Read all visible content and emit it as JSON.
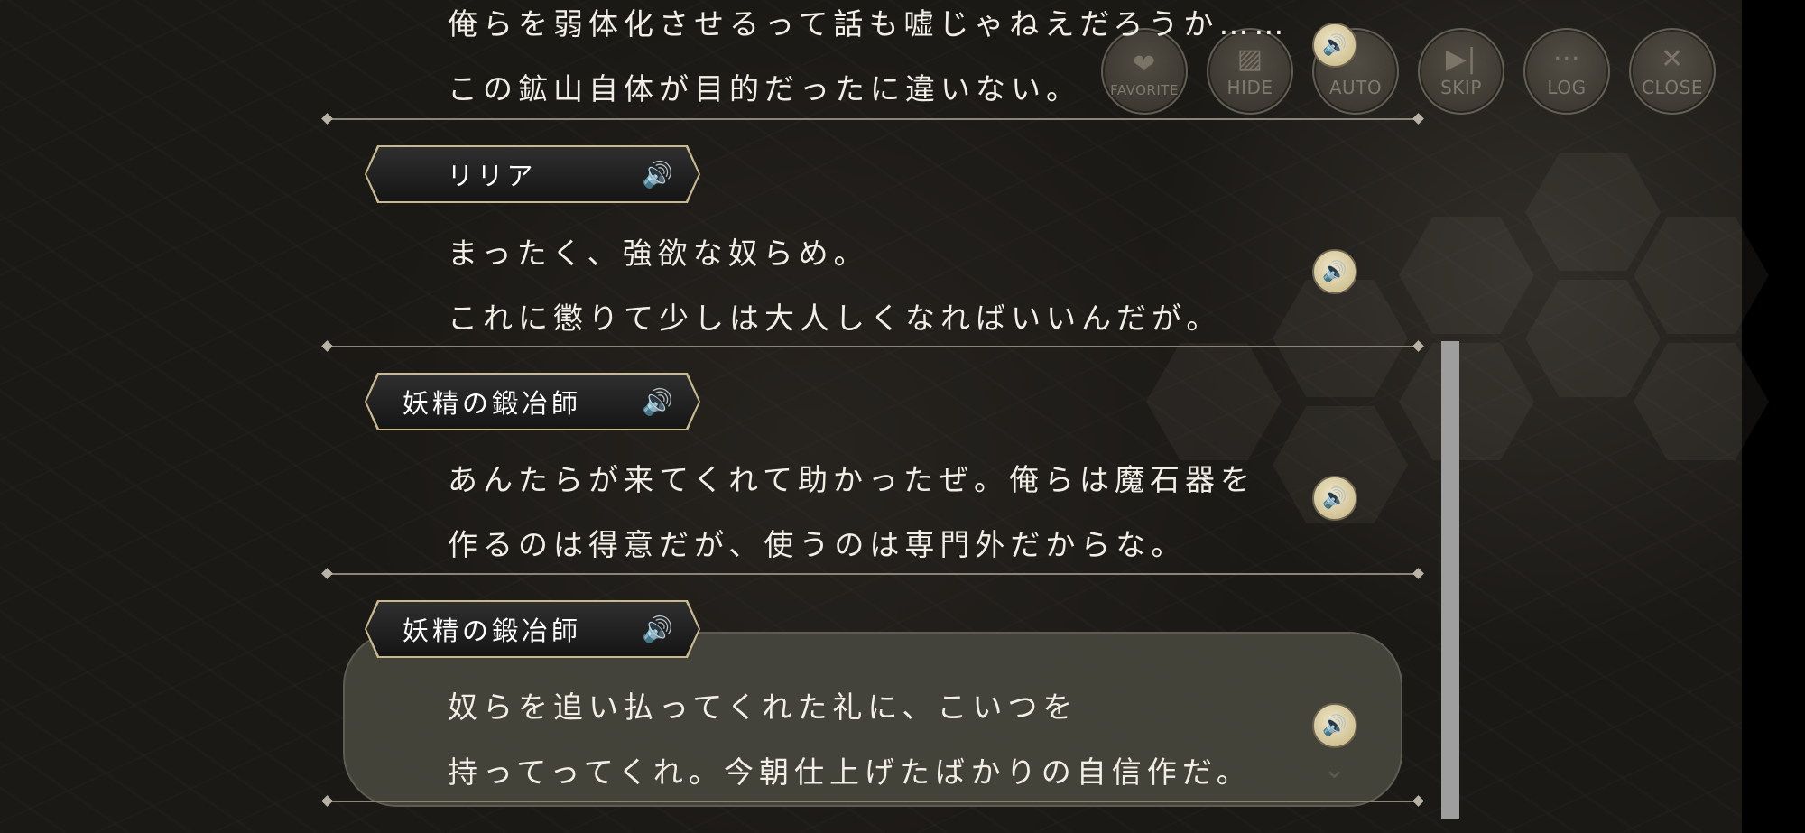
{
  "toolbar": {
    "favorite": "FAVORITE",
    "hide": "HIDE",
    "auto": "AUTO",
    "skip": "SKIP",
    "log": "LOG",
    "close": "CLOSE",
    "icons": [
      "heart-icon",
      "hide-icon",
      "auto-icon",
      "skip-icon",
      "log-icon",
      "close-icon"
    ]
  },
  "log": {
    "entry0": {
      "line1": "俺らを弱体化させるって話も嘘じゃねえだろうか……",
      "line2": "この鉱山自体が目的だったに違いない。"
    },
    "entry1": {
      "name": "リリア",
      "line1": "まったく、強欲な奴らめ。",
      "line2": "これに懲りて少しは大人しくなればいいんだが。"
    },
    "entry2": {
      "name": "妖精の鍛冶師",
      "line1": "あんたらが来てくれて助かったぜ。俺らは魔石器を",
      "line2": "作るのは得意だが、使うのは専門外だからな。"
    },
    "entry3": {
      "name": "妖精の鍛冶師",
      "line1": "奴らを追い払ってくれた礼に、こいつを",
      "line2": "持ってってくれ。今朝仕上げたばかりの自信作だ。"
    }
  },
  "colors": {
    "accent_gold": "#c8b98e",
    "text": "#f1eee6",
    "panel": "#48463e"
  }
}
